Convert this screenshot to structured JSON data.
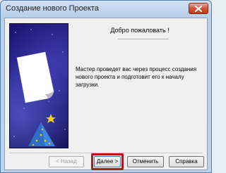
{
  "window": {
    "title": "Создание нового Проекта"
  },
  "content": {
    "welcome": "Добро пожаловать !",
    "description": "Мастер проведет вас через процесс создания нового проекта и подготовит его к началу загрузки."
  },
  "buttons": {
    "back": "< Назад",
    "next": "Далее >",
    "cancel": "Отменить",
    "help": "Справка"
  },
  "colors": {
    "highlight": "#b01c1c",
    "image_background": "#2b2a9a",
    "hat": "#3f86e0",
    "star": "#f4d21c"
  }
}
